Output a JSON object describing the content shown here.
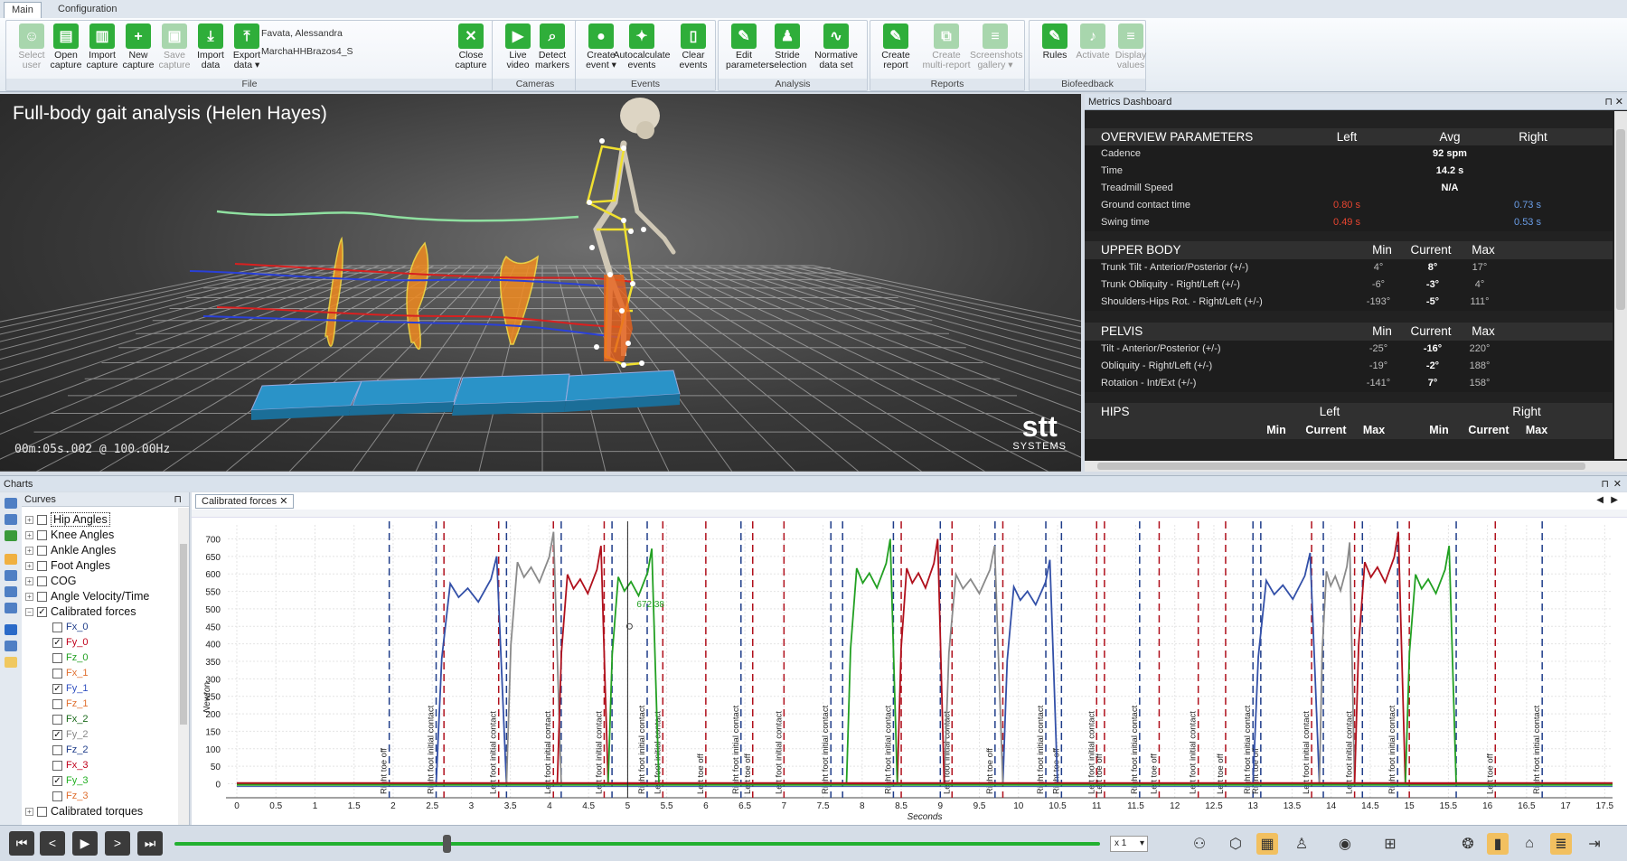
{
  "ribbon": {
    "tabs": [
      {
        "label": "Main",
        "active": true
      },
      {
        "label": "Configuration",
        "active": false
      }
    ],
    "patient_name": "Favata, Alessandra",
    "capture_name": "MarchaHHBrazos4_S",
    "groups": [
      {
        "label": "File",
        "buttons": [
          {
            "label1": "Select",
            "label2": "user",
            "icon": "user-icon",
            "enabled": false
          },
          {
            "label1": "Open",
            "label2": "capture",
            "icon": "folder-open-icon",
            "enabled": true
          },
          {
            "label1": "Import",
            "label2": "capture",
            "icon": "printer-icon",
            "enabled": true
          },
          {
            "label1": "New",
            "label2": "capture",
            "icon": "new-file-icon",
            "enabled": true
          },
          {
            "label1": "Save",
            "label2": "capture",
            "icon": "save-icon",
            "enabled": false
          },
          {
            "label1": "Import",
            "label2": "data",
            "icon": "import-icon",
            "enabled": true
          },
          {
            "label1": "Export",
            "label2": "data ▾",
            "icon": "export-icon",
            "enabled": true
          },
          {
            "label1": "Close",
            "label2": "capture",
            "icon": "close-icon",
            "enabled": true
          }
        ]
      },
      {
        "label": "Cameras",
        "buttons": [
          {
            "label1": "Live",
            "label2": "video",
            "icon": "video-camera-icon",
            "enabled": true
          },
          {
            "label1": "Detect",
            "label2": "markers",
            "icon": "magnifier-icon",
            "enabled": true
          }
        ]
      },
      {
        "label": "Events",
        "buttons": [
          {
            "label1": "Create",
            "label2": "event ▾",
            "icon": "location-pin-icon",
            "enabled": true
          },
          {
            "label1": "Autocalculate",
            "label2": "events",
            "icon": "magic-wand-icon",
            "enabled": true
          },
          {
            "label1": "Clear",
            "label2": "events",
            "icon": "trash-icon",
            "enabled": true
          }
        ]
      },
      {
        "label": "Analysis",
        "buttons": [
          {
            "label1": "Edit",
            "label2": "parameters",
            "icon": "edit-icon",
            "enabled": true
          },
          {
            "label1": "Stride",
            "label2": "selection",
            "icon": "walking-icon",
            "enabled": true
          },
          {
            "label1": "Normative",
            "label2": "data set",
            "icon": "line-chart-icon",
            "enabled": true
          }
        ]
      },
      {
        "label": "Reports",
        "buttons": [
          {
            "label1": "Create",
            "label2": "report",
            "icon": "report-icon",
            "enabled": true
          },
          {
            "label1": "Create",
            "label2": "multi-report",
            "icon": "multi-report-icon",
            "enabled": false
          },
          {
            "label1": "Screenshots",
            "label2": "gallery ▾",
            "icon": "gallery-icon",
            "enabled": false
          }
        ]
      },
      {
        "label": "Biofeedback",
        "buttons": [
          {
            "label1": "Rules",
            "label2": "",
            "icon": "rules-icon",
            "enabled": true
          },
          {
            "label1": "Activate",
            "label2": "",
            "icon": "bell-icon",
            "enabled": false
          },
          {
            "label1": "Display",
            "label2": "values",
            "icon": "list-icon",
            "enabled": false
          }
        ]
      }
    ]
  },
  "view3d": {
    "title": "Full-body gait analysis (Helen Hayes)",
    "timecode": "00m:05s.002 @ 100.00Hz",
    "logo_main": "stt",
    "logo_sub": "SYSTEMS"
  },
  "metrics": {
    "panel_title": "Metrics Dashboard",
    "overview": {
      "title": "OVERVIEW PARAMETERS",
      "col_left": "Left",
      "col_avg": "Avg",
      "col_right": "Right",
      "rows": [
        {
          "label": "Cadence",
          "left": "",
          "avg": "92 spm",
          "right": ""
        },
        {
          "label": "Time",
          "left": "",
          "avg": "14.2 s",
          "right": ""
        },
        {
          "label": "Treadmill Speed",
          "left": "",
          "avg": "N/A",
          "right": ""
        },
        {
          "label": "Ground contact time",
          "left": "0.80 s",
          "avg": "",
          "right": "0.73 s"
        },
        {
          "label": "Swing time",
          "left": "0.49 s",
          "avg": "",
          "right": "0.53 s"
        }
      ]
    },
    "upper_body": {
      "title": "UPPER BODY",
      "col_min": "Min",
      "col_current": "Current",
      "col_max": "Max",
      "rows": [
        {
          "label": "Trunk Tilt - Anterior/Posterior (+/-)",
          "min": "4°",
          "current": "8°",
          "max": "17°"
        },
        {
          "label": "Trunk Obliquity - Right/Left (+/-)",
          "min": "-6°",
          "current": "-3°",
          "max": "4°"
        },
        {
          "label": "Shoulders-Hips Rot. - Right/Left (+/-)",
          "min": "-193°",
          "current": "-5°",
          "max": "111°"
        }
      ]
    },
    "pelvis": {
      "title": "PELVIS",
      "col_min": "Min",
      "col_current": "Current",
      "col_max": "Max",
      "rows": [
        {
          "label": "Tilt - Anterior/Posterior (+/-)",
          "min": "-25°",
          "current": "-16°",
          "max": "220°"
        },
        {
          "label": "Obliquity - Right/Left (+/-)",
          "min": "-19°",
          "current": "-2°",
          "max": "188°"
        },
        {
          "label": "Rotation - Int/Ext (+/-)",
          "min": "-141°",
          "current": "7°",
          "max": "158°"
        }
      ]
    },
    "hips": {
      "title": "HIPS",
      "left": "Left",
      "right": "Right",
      "sub": [
        "Min",
        "Current",
        "Max",
        "Min",
        "Current",
        "Max"
      ]
    }
  },
  "charts": {
    "panel_title": "Charts",
    "curves_title": "Curves",
    "tab_label": "Calibrated forces",
    "tree": [
      {
        "label": "Hip Angles",
        "level": 0,
        "checked": false,
        "color": "#111111"
      },
      {
        "label": "Knee Angles",
        "level": 0,
        "checked": false,
        "color": "#111111"
      },
      {
        "label": "Ankle Angles",
        "level": 0,
        "checked": false,
        "color": "#111111"
      },
      {
        "label": "Foot Angles",
        "level": 0,
        "checked": false,
        "color": "#111111"
      },
      {
        "label": "COG",
        "level": 0,
        "checked": false,
        "color": "#111111"
      },
      {
        "label": "Angle Velocity/Time",
        "level": 0,
        "checked": false,
        "color": "#111111"
      },
      {
        "label": "Calibrated forces",
        "level": 0,
        "checked": true,
        "color": "#111111",
        "expanded": true
      },
      {
        "label": "Fx_0",
        "level": 1,
        "checked": false,
        "color": "#1f3d8a"
      },
      {
        "label": "Fy_0",
        "level": 1,
        "checked": true,
        "color": "#c0001a"
      },
      {
        "label": "Fz_0",
        "level": 1,
        "checked": false,
        "color": "#22a022"
      },
      {
        "label": "Fx_1",
        "level": 1,
        "checked": false,
        "color": "#e07030"
      },
      {
        "label": "Fy_1",
        "level": 1,
        "checked": true,
        "color": "#3050c0"
      },
      {
        "label": "Fz_1",
        "level": 1,
        "checked": false,
        "color": "#e07030"
      },
      {
        "label": "Fx_2",
        "level": 1,
        "checked": false,
        "color": "#1a6a1a"
      },
      {
        "label": "Fy_2",
        "level": 1,
        "checked": true,
        "color": "#888888"
      },
      {
        "label": "Fz_2",
        "level": 1,
        "checked": false,
        "color": "#1f3d8a"
      },
      {
        "label": "Fx_3",
        "level": 1,
        "checked": false,
        "color": "#c0001a"
      },
      {
        "label": "Fy_3",
        "level": 1,
        "checked": true,
        "color": "#22b022"
      },
      {
        "label": "Fz_3",
        "level": 1,
        "checked": false,
        "color": "#e07030"
      },
      {
        "label": "Calibrated torques",
        "level": 0,
        "checked": false,
        "color": "#111111"
      }
    ],
    "cursor_label": "672.38"
  },
  "chart_data": {
    "type": "line",
    "title": "",
    "xlabel": "Seconds",
    "ylabel": "Newton",
    "xlim": [
      0,
      17.6
    ],
    "ylim": [
      -40,
      740
    ],
    "x_ticks": [
      0,
      0.5,
      1,
      1.5,
      2,
      2.5,
      3,
      3.5,
      4,
      4.5,
      5,
      5.5,
      6,
      6.5,
      7,
      7.5,
      8,
      8.5,
      9,
      9.5,
      10,
      10.5,
      11,
      11.5,
      12,
      12.5,
      13,
      13.5,
      14,
      14.5,
      15,
      15.5,
      16,
      16.5,
      17,
      17.5
    ],
    "y_ticks": [
      0,
      50,
      100,
      150,
      200,
      250,
      300,
      350,
      400,
      450,
      500,
      550,
      600,
      650,
      700
    ],
    "cursor_x": 5.0,
    "series": [
      {
        "name": "Fy_1",
        "color": "#3350a8",
        "steps": [
          [
            2.55,
            3.45,
            650
          ],
          [
            9.8,
            10.5,
            640
          ],
          [
            13.0,
            13.85,
            660
          ]
        ]
      },
      {
        "name": "Fy_2",
        "color": "#8a8a8a",
        "steps": [
          [
            3.45,
            4.15,
            720
          ],
          [
            9.05,
            9.8,
            680
          ],
          [
            13.85,
            14.3,
            690
          ]
        ]
      },
      {
        "name": "Fy_0",
        "color": "#b0101c",
        "steps": [
          [
            4.1,
            4.75,
            680
          ],
          [
            8.45,
            9.05,
            700
          ],
          [
            14.3,
            14.95,
            720
          ]
        ]
      },
      {
        "name": "Fy_3",
        "color": "#22a022",
        "steps": [
          [
            4.75,
            5.4,
            672
          ],
          [
            7.8,
            8.45,
            700
          ],
          [
            14.95,
            15.6,
            680
          ]
        ]
      }
    ],
    "events": [
      {
        "x": 1.95,
        "label": "Right toe off",
        "color": "#1f3d8a"
      },
      {
        "x": 2.55,
        "label": "Right foot initial contact",
        "color": "#1f3d8a"
      },
      {
        "x": 2.65,
        "label": "",
        "color": "#b0101c"
      },
      {
        "x": 3.35,
        "label": "Left foot initial contact",
        "color": "#b0101c"
      },
      {
        "x": 3.45,
        "label": "",
        "color": "#1f3d8a"
      },
      {
        "x": 4.05,
        "label": "Left foot initial contact",
        "color": "#b0101c"
      },
      {
        "x": 4.15,
        "label": "",
        "color": "#1f3d8a"
      },
      {
        "x": 4.7,
        "label": "Left foot initial contact",
        "color": "#b0101c"
      },
      {
        "x": 4.8,
        "label": "",
        "color": "#1f3d8a"
      },
      {
        "x": 5.25,
        "label": "Right foot initial contact",
        "color": "#1f3d8a"
      },
      {
        "x": 5.45,
        "label": "Left foot initial contact",
        "color": "#b0101c"
      },
      {
        "x": 6.0,
        "label": "Left toe off",
        "color": "#b0101c"
      },
      {
        "x": 6.45,
        "label": "Right foot initial contact",
        "color": "#1f3d8a"
      },
      {
        "x": 6.6,
        "label": "Left toe off",
        "color": "#b0101c"
      },
      {
        "x": 7.0,
        "label": "Left foot initial contact",
        "color": "#b0101c"
      },
      {
        "x": 7.6,
        "label": "Right foot initial contact",
        "color": "#1f3d8a"
      },
      {
        "x": 7.75,
        "label": "",
        "color": "#1f3d8a"
      },
      {
        "x": 8.4,
        "label": "Right foot initial contact",
        "color": "#1f3d8a"
      },
      {
        "x": 8.5,
        "label": "",
        "color": "#b0101c"
      },
      {
        "x": 9.0,
        "label": "",
        "color": "#1f3d8a"
      },
      {
        "x": 9.15,
        "label": "Left foot initial contact",
        "color": "#b0101c"
      },
      {
        "x": 9.7,
        "label": "Right toe off",
        "color": "#1f3d8a"
      },
      {
        "x": 9.8,
        "label": "",
        "color": "#b0101c"
      },
      {
        "x": 10.35,
        "label": "Right foot initial contact",
        "color": "#1f3d8a"
      },
      {
        "x": 10.55,
        "label": "Right toe off",
        "color": "#1f3d8a"
      },
      {
        "x": 11.0,
        "label": "Left foot initial contact",
        "color": "#b0101c"
      },
      {
        "x": 11.1,
        "label": "Left toe off",
        "color": "#b0101c"
      },
      {
        "x": 11.55,
        "label": "Right foot initial contact",
        "color": "#1f3d8a"
      },
      {
        "x": 11.8,
        "label": "Left toe off",
        "color": "#b0101c"
      },
      {
        "x": 12.3,
        "label": "Left foot initial contact",
        "color": "#b0101c"
      },
      {
        "x": 12.65,
        "label": "Left toe off",
        "color": "#b0101c"
      },
      {
        "x": 13.0,
        "label": "Right foot initial contact",
        "color": "#1f3d8a"
      },
      {
        "x": 13.1,
        "label": "Right toe off",
        "color": "#1f3d8a"
      },
      {
        "x": 13.75,
        "label": "Left foot initial contact",
        "color": "#b0101c"
      },
      {
        "x": 13.9,
        "label": "",
        "color": "#1f3d8a"
      },
      {
        "x": 14.3,
        "label": "Left foot initial contact",
        "color": "#b0101c"
      },
      {
        "x": 14.4,
        "label": "",
        "color": "#1f3d8a"
      },
      {
        "x": 14.85,
        "label": "Right foot initial contact",
        "color": "#1f3d8a"
      },
      {
        "x": 15.0,
        "label": "",
        "color": "#b0101c"
      },
      {
        "x": 15.6,
        "label": "",
        "color": "#1f3d8a"
      },
      {
        "x": 16.1,
        "label": "Left toe off",
        "color": "#b0101c"
      },
      {
        "x": 16.7,
        "label": "Right foot initial contact",
        "color": "#1f3d8a"
      }
    ]
  },
  "playback": {
    "speed": "x 1",
    "position_fraction": 0.29
  }
}
